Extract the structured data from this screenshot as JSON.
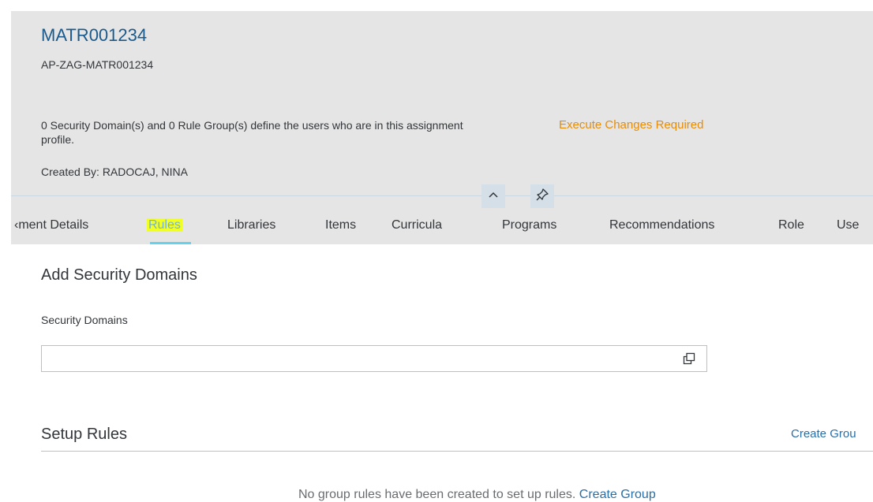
{
  "header": {
    "title": "MATR001234",
    "subtitle": "AP-ZAG-MATR001234",
    "description": "0 Security Domain(s) and 0 Rule Group(s) define the users who are in this assignment profile.",
    "status": "Execute Changes Required",
    "created_by": "Created By: RADOCAJ, NINA"
  },
  "tabs": [
    {
      "label": "Assignment Details",
      "shown": "‹ment Details"
    },
    {
      "label": "Rules"
    },
    {
      "label": "Libraries"
    },
    {
      "label": "Items"
    },
    {
      "label": "Curricula"
    },
    {
      "label": "Programs"
    },
    {
      "label": "Recommendations"
    },
    {
      "label": "Role"
    },
    {
      "label": "Use"
    }
  ],
  "add_security_domains": {
    "title": "Add Security Domains",
    "field_label": "Security Domains",
    "value": ""
  },
  "setup_rules": {
    "title": "Setup Rules",
    "create_group_label": "Create Grou"
  },
  "footer_message": {
    "text": "No group rules have been created to set up rules. ",
    "link": "Create Group"
  },
  "colors": {
    "title": "#1a5a8c",
    "status": "#e78c07",
    "link": "#2a6ea6",
    "highlight": "#f0ff24",
    "tab_indicator": "#63d2ec"
  },
  "icons": [
    "chevron-up-icon",
    "pin-icon",
    "value-help-icon"
  ]
}
